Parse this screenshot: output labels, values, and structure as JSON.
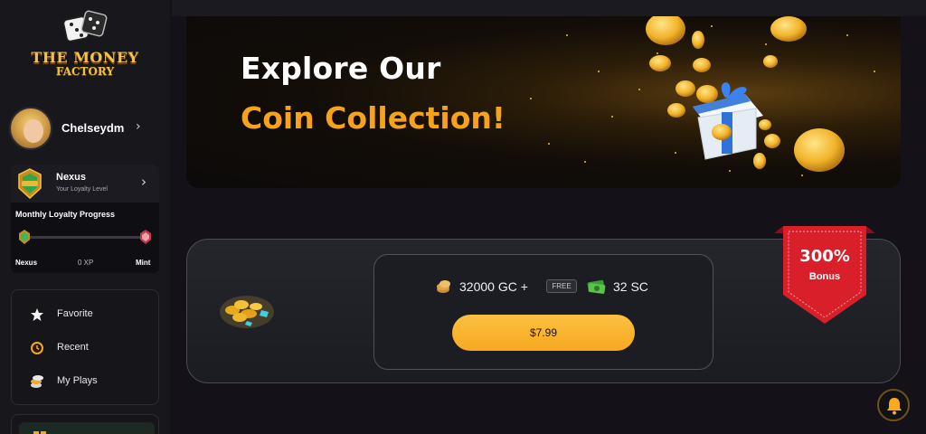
{
  "sidebar": {
    "logo": {
      "line1": "THE MONEY",
      "line2": "FACTORY"
    },
    "profile": {
      "username": "Chelseydm"
    },
    "loyalty": {
      "level": "Nexus",
      "level_caption": "Your Loyalty Level",
      "progress_title": "Monthly Loyalty Progress",
      "progress_fraction": 0,
      "current_tier": "Nexus",
      "xp": "0 XP",
      "next_tier": "Mint"
    },
    "nav": [
      {
        "label": "Favorite",
        "icon": "star-icon"
      },
      {
        "label": "Recent",
        "icon": "clock-icon"
      },
      {
        "label": "My Plays",
        "icon": "chips-icon"
      }
    ]
  },
  "banner": {
    "line1": "Explore Our",
    "line2": "Coin Collection!"
  },
  "package": {
    "gc_amount": "32000 GC +",
    "free_tag": "FREE",
    "sc_amount": "32 SC",
    "price": "$7.99",
    "bonus_percent": "300%",
    "bonus_label": "Bonus"
  },
  "colors": {
    "accent": "#f7a920",
    "banner_highlight": "#f7a21c",
    "ribbon": "#d81f2a"
  }
}
